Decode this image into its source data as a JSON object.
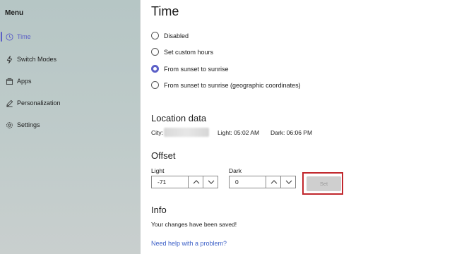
{
  "sidebar": {
    "menu_title": "Menu",
    "items": [
      {
        "label": "Time",
        "icon": "clock-icon",
        "active": true
      },
      {
        "label": "Switch Modes",
        "icon": "lightning-icon",
        "active": false
      },
      {
        "label": "Apps",
        "icon": "apps-icon",
        "active": false
      },
      {
        "label": "Personalization",
        "icon": "pen-icon",
        "active": false
      },
      {
        "label": "Settings",
        "icon": "gear-icon",
        "active": false
      }
    ],
    "accent": "#5b5fc7"
  },
  "main": {
    "title": "Time",
    "radios": [
      {
        "label": "Disabled",
        "checked": false
      },
      {
        "label": "Set custom hours",
        "checked": false
      },
      {
        "label": "From sunset to sunrise",
        "checked": true
      },
      {
        "label": "From sunset to sunrise (geographic coordinates)",
        "checked": false
      }
    ],
    "location": {
      "title": "Location data",
      "city_label": "City:",
      "light": "Light: 05:02 AM",
      "dark": "Dark: 06:06 PM"
    },
    "offset": {
      "title": "Offset",
      "light_label": "Light",
      "light_value": "-71",
      "dark_label": "Dark",
      "dark_value": "0",
      "set_label": "Set"
    },
    "info": {
      "title": "Info",
      "message": "Your changes have been saved!",
      "help_link": "Need help with a problem?"
    }
  }
}
